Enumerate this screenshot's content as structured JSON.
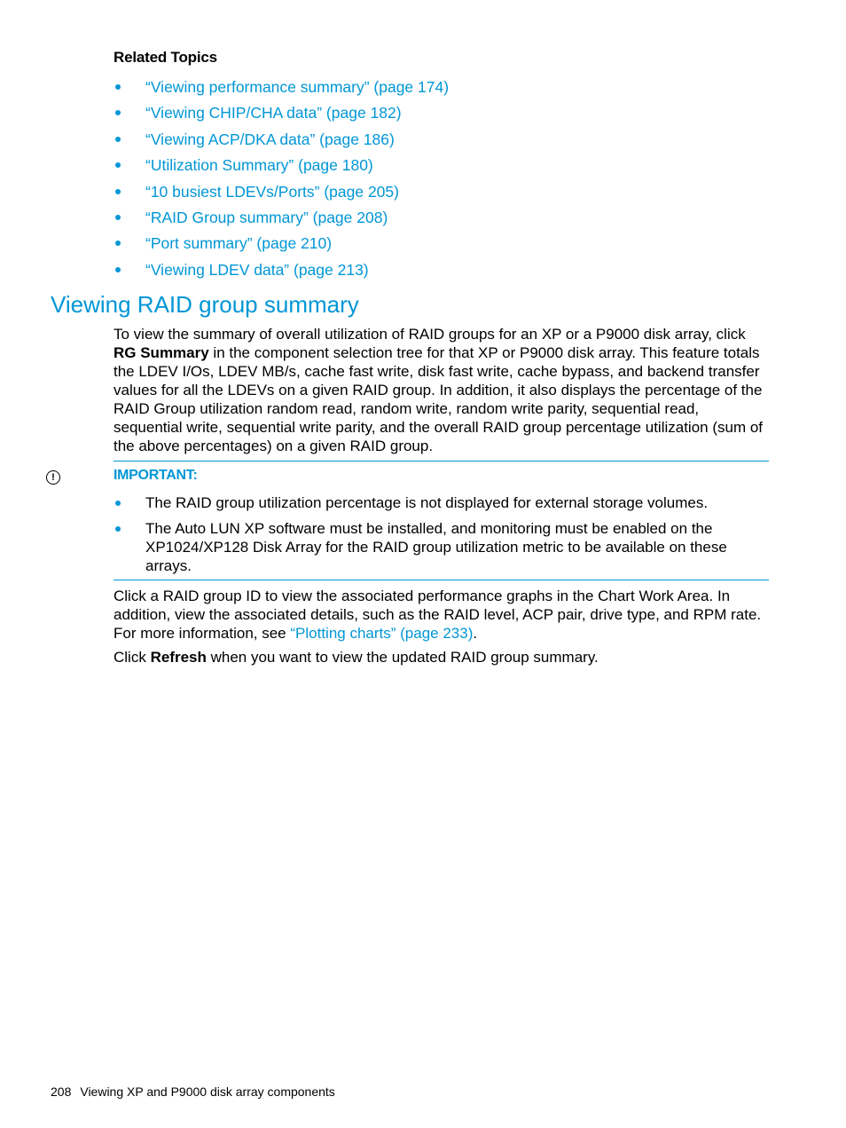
{
  "related_topics": {
    "title": "Related Topics",
    "items": [
      {
        "label": "“Viewing performance summary” (page 174)"
      },
      {
        "label": "“Viewing CHIP/CHA data” (page 182)"
      },
      {
        "label": "“Viewing ACP/DKA data” (page 186)"
      },
      {
        "label": "“Utilization Summary” (page 180)"
      },
      {
        "label": "“10 busiest LDEVs/Ports” (page 205)"
      },
      {
        "label": "“RAID Group summary” (page 208)"
      },
      {
        "label": "“Port summary” (page 210)"
      },
      {
        "label": "“Viewing LDEV data” (page 213)"
      }
    ]
  },
  "section": {
    "heading": "Viewing RAID group summary",
    "intro": {
      "part1": "To view the summary of overall utilization of RAID groups for an XP or a P9000 disk array, click ",
      "bold": "RG Summary",
      "part2": " in the component selection tree for that XP or P9000 disk array. This feature totals the LDEV I/Os, LDEV MB/s, cache fast write, disk fast write, cache bypass, and backend transfer values for all the LDEVs on a given RAID group. In addition, it also displays the percentage of the RAID Group utilization random read, random write, random write parity, sequential read, sequential write, sequential write parity, and the overall RAID group percentage utilization (sum of the above percentages) on a given RAID group."
    },
    "important": {
      "icon": "exclamation-circle-icon",
      "label": "IMPORTANT:",
      "items": [
        {
          "text": "The RAID group utilization percentage is not displayed for external storage volumes."
        },
        {
          "text": "The Auto LUN XP software must be installed, and monitoring must be enabled on the XP1024/XP128 Disk Array for the RAID group utilization metric to be available on these arrays."
        }
      ]
    },
    "click_para": {
      "text": "Click a RAID group ID to view the associated performance graphs in the Chart Work Area. In addition, view the associated details, such as the RAID level, ACP pair, drive type, and RPM rate. For more information, see ",
      "link": "“Plotting charts” (page 233)",
      "end": "."
    },
    "refresh_para": {
      "part1": "Click ",
      "bold": "Refresh",
      "part2": " when you want to view the updated RAID group summary."
    }
  },
  "footer": {
    "page_number": "208",
    "chapter": "Viewing XP and P9000 disk array components"
  },
  "colors": {
    "accent": "#0096d6",
    "text": "#000000"
  }
}
